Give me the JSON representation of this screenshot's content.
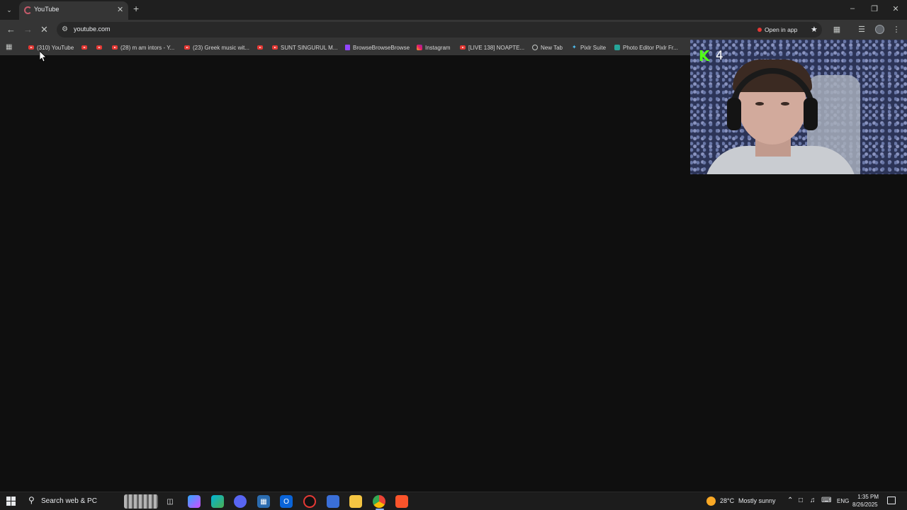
{
  "browser": {
    "tab": {
      "title": "YouTube"
    },
    "url": "youtube.com",
    "open_in_app": "Open in app"
  },
  "bookmarks": [
    {
      "label": "(310) YouTube",
      "icon": "youtube-icon"
    },
    {
      "label": "",
      "icon": "youtube-icon"
    },
    {
      "label": "",
      "icon": "youtube-icon"
    },
    {
      "label": "(28) m am intors - Y...",
      "icon": "youtube-icon"
    },
    {
      "label": "(23) Greek music wit...",
      "icon": "youtube-icon"
    },
    {
      "label": "",
      "icon": "youtube-icon"
    },
    {
      "label": "SUNT SINGURUL M...",
      "icon": "youtube-icon"
    },
    {
      "label": "BrowseBrowseBrowse",
      "icon": "twitch-icon"
    },
    {
      "label": "Instagram",
      "icon": "instagram-icon"
    },
    {
      "label": "[LIVE 138] NOAPTE...",
      "icon": "youtube-icon"
    },
    {
      "label": "New Tab",
      "icon": "globe-icon"
    },
    {
      "label": "Pixlr Suite",
      "icon": "pixlr-icon"
    },
    {
      "label": "Photo Editor Pixlr Fr...",
      "icon": "pixlr-editor-icon"
    }
  ],
  "webcam": {
    "logo": "K",
    "viewer_count": "4"
  },
  "taskbar": {
    "search_placeholder": "Search web & PC",
    "weather_temp": "28°C",
    "weather_desc": "Mostly sunny",
    "language": "ENG",
    "time": "1:35 PM",
    "date": "8/26/2025"
  },
  "colors": {
    "page_bg": "#0f0f0f",
    "toolbar_bg": "#353535",
    "youtube_red": "#e53935",
    "kick_green": "#53fc18"
  }
}
